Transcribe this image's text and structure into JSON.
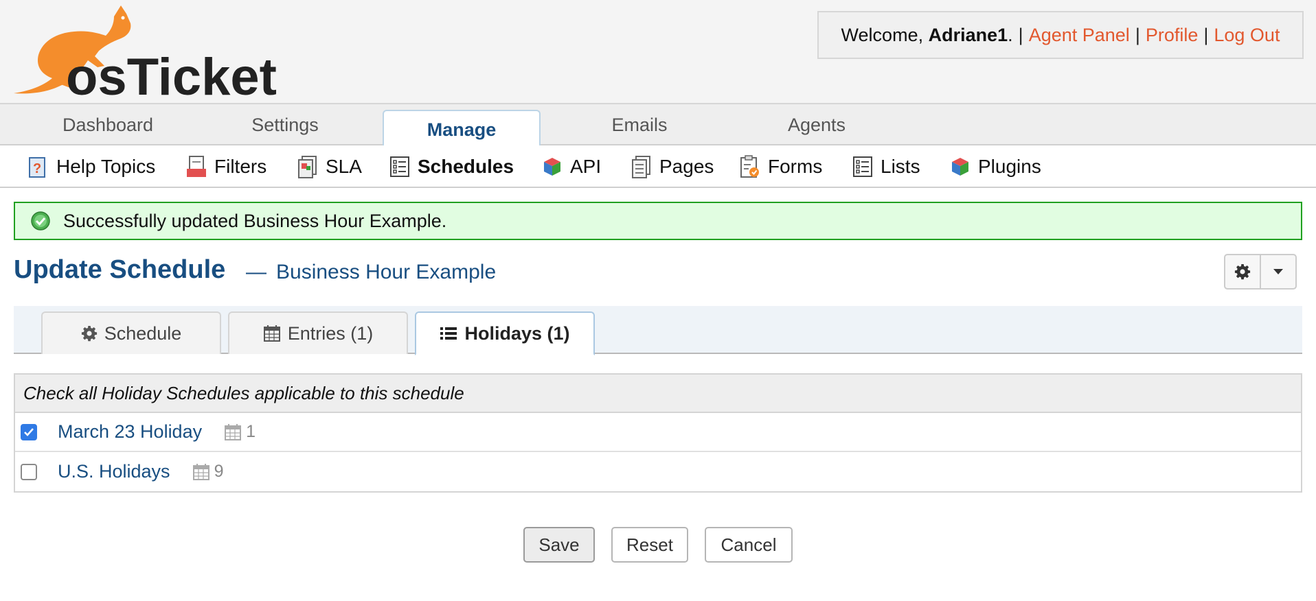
{
  "brand": {
    "logo_text": "osTicket",
    "accent": "#f48d2c"
  },
  "user_bar": {
    "welcome_prefix": "Welcome, ",
    "username": "Adriane1",
    "after_name": ".",
    "agent_panel": "Agent Panel",
    "profile": "Profile",
    "logout": "Log Out",
    "separator": "|"
  },
  "main_nav": [
    {
      "label": "Dashboard"
    },
    {
      "label": "Settings"
    },
    {
      "label": "Manage",
      "active": true
    },
    {
      "label": "Emails"
    },
    {
      "label": "Agents"
    }
  ],
  "sub_nav": [
    {
      "label": "Help Topics",
      "icon": "help-topics-icon"
    },
    {
      "label": "Filters",
      "icon": "filters-icon"
    },
    {
      "label": "SLA",
      "icon": "sla-icon"
    },
    {
      "label": "Schedules",
      "icon": "schedules-icon",
      "active": true
    },
    {
      "label": "API",
      "icon": "api-icon"
    },
    {
      "label": "Pages",
      "icon": "pages-icon"
    },
    {
      "label": "Forms",
      "icon": "forms-icon"
    },
    {
      "label": "Lists",
      "icon": "lists-icon"
    },
    {
      "label": "Plugins",
      "icon": "plugins-icon"
    }
  ],
  "alert": {
    "message": "Successfully updated Business Hour Example.",
    "icon": "success-check-icon"
  },
  "page": {
    "title": "Update Schedule",
    "dash": "—",
    "subtitle": "Business Hour Example"
  },
  "tabs": [
    {
      "label": "Schedule",
      "icon": "gear-icon"
    },
    {
      "label": "Entries (1)",
      "icon": "calendar-icon"
    },
    {
      "label": "Holidays (1)",
      "icon": "list-icon",
      "active": true
    }
  ],
  "holidays_table": {
    "header": "Check all Holiday Schedules applicable to this schedule",
    "rows": [
      {
        "name": "March 23 Holiday",
        "count": "1",
        "checked": true
      },
      {
        "name": "U.S. Holidays",
        "count": "9",
        "checked": false
      }
    ]
  },
  "actions": {
    "save": "Save",
    "reset": "Reset",
    "cancel": "Cancel"
  },
  "colors": {
    "link": "#184e81",
    "orange_link": "#e2582e",
    "success_bg": "#e1fde1",
    "success_border": "#20a020",
    "checkbox": "#2f7ae5"
  }
}
